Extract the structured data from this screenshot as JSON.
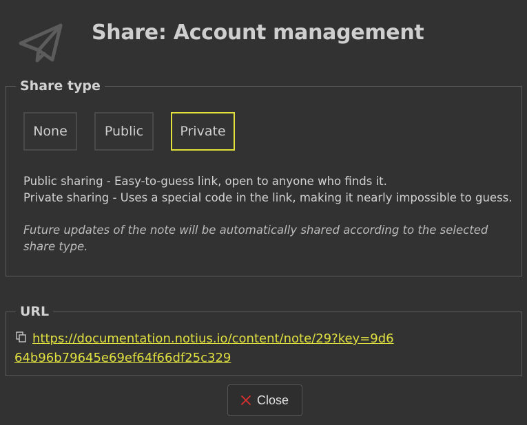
{
  "dialog": {
    "title": "Share: Account management"
  },
  "share_type": {
    "legend": "Share type",
    "options": [
      {
        "label": "None",
        "selected": false
      },
      {
        "label": "Public",
        "selected": false
      },
      {
        "label": "Private",
        "selected": true
      }
    ],
    "selected_border_color": "#e2e23a",
    "description_lines": [
      "Public sharing - Easy-to-guess link, open to anyone who finds it.",
      "Private sharing - Uses a special code in the link, making it nearly impossible to guess."
    ],
    "note": "Future updates of the note will be automatically shared according to the selected share type."
  },
  "url_section": {
    "legend": "URL",
    "url": "https://documentation.notius.io/content/note/29?key=9d664b96b79645e69ef64f66df25c329",
    "link_color": "#e0e040"
  },
  "footer": {
    "close_label": "Close",
    "close_icon_color": "#e03030"
  },
  "icons": {
    "header": "paper-plane-icon",
    "copy": "copy-icon",
    "close": "close-x-icon"
  }
}
